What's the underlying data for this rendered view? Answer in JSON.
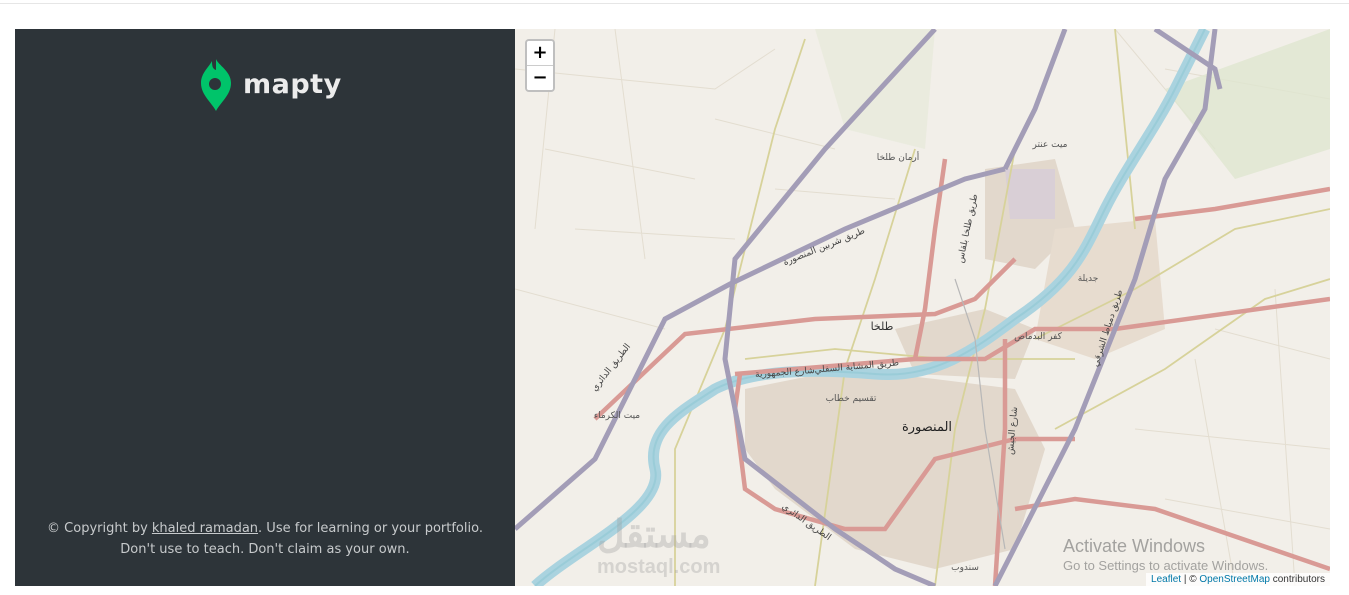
{
  "app": {
    "logo_text": "mapty",
    "brand_color": "#00c46a"
  },
  "footer": {
    "prefix": "© Copyright by ",
    "author": "khaled ramadan",
    "line1_rest": ". Use for learning or your portfolio.",
    "line2": "Don't use to teach. Don't claim as your own."
  },
  "map": {
    "zoom_in": "+",
    "zoom_out": "−",
    "attribution_leaflet": "Leaflet",
    "attribution_sep": " | © ",
    "attribution_osm": "OpenStreetMap",
    "attribution_suffix": " contributors",
    "places": {
      "mansoura": "المنصورة",
      "talkha": "طلخا",
      "kafr_dimashq": "كفر البدماص",
      "mit_antar": "ميت عنتر",
      "gadila": "جديلة",
      "taqsim": "تقسيم خطاب",
      "mit_karma": "ميت الكرماء",
      "arman": "أرمان طلخا",
      "sandoub": "سندوب"
    },
    "roads": {
      "dairy": "الطريق الدائري",
      "dairy2": "الطريق الدائري",
      "shirbin": "طريق شربين المنصورة",
      "talkha_belqas": "طريق طلخا بلقاس",
      "gomhoria": "شارع الجمهورية",
      "mashaya": "طريق المشاية السفلي",
      "damietta": "طريق دمياط الشرقي",
      "geish": "شارع الجيش"
    }
  },
  "os": {
    "activate_title": "Activate Windows",
    "activate_sub": "Go to Settings to activate Windows."
  },
  "watermark": {
    "arabic": "مستقل",
    "latin": "mostaql.com"
  }
}
